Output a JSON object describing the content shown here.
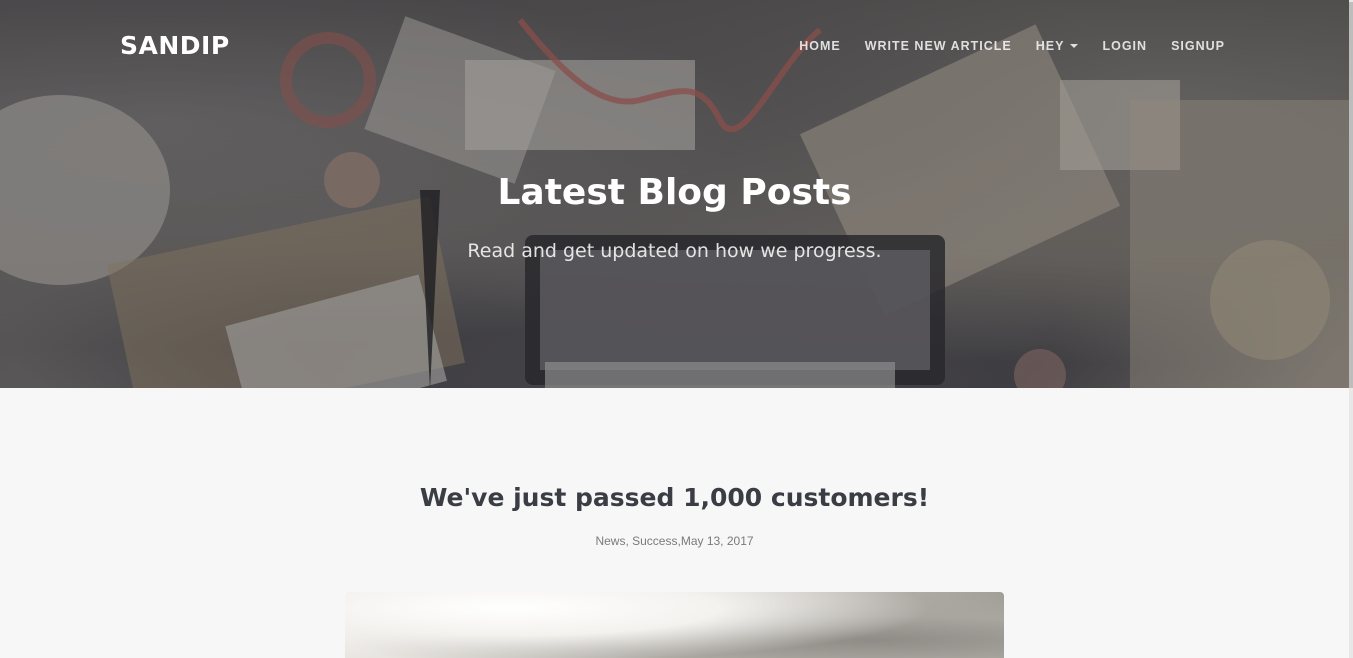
{
  "brand": "SANDIP",
  "nav": {
    "items": [
      {
        "label": "HOME"
      },
      {
        "label": "WRITE NEW ARTICLE"
      },
      {
        "label": "HEY",
        "dropdown": true
      },
      {
        "label": "LOGIN"
      },
      {
        "label": "SIGNUP"
      }
    ]
  },
  "hero": {
    "title": "Latest Blog Posts",
    "subtitle": "Read and get updated on how we progress."
  },
  "post": {
    "title": "We've just passed 1,000 customers!",
    "categories": [
      "News",
      "Success"
    ],
    "date": "May 13, 2017"
  },
  "colors": {
    "title_text": "#3a3d44",
    "page_background": "#f7f7f7",
    "meta_text": "#7a7a7a"
  },
  "icons": {
    "dropdown": "caret-down-icon"
  }
}
